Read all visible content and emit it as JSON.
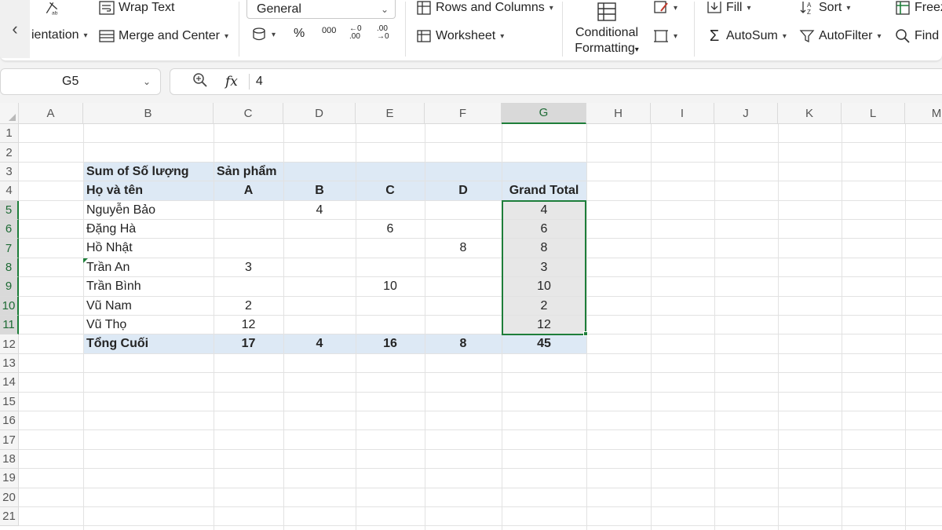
{
  "ribbon": {
    "orientation_label": "ientation",
    "wrap_text": "Wrap Text",
    "merge_center": "Merge and Center",
    "number_format": "General",
    "percent": "%",
    "comma": "000",
    "dec_increase": "←0 .00",
    "dec_decrease": ".00 →0",
    "rows_columns": "Rows and Columns",
    "worksheet": "Worksheet",
    "conditional_line1": "Conditional",
    "conditional_line2": "Formatting",
    "fill": "Fill",
    "sort": "Sort",
    "autosum": "AutoSum",
    "autofilter": "AutoFilter",
    "freeze": "Freez",
    "find": "Find"
  },
  "formula_bar": {
    "cell_ref": "G5",
    "fx": "fx",
    "value": "4"
  },
  "columns": [
    "A",
    "B",
    "C",
    "D",
    "E",
    "F",
    "G",
    "H",
    "I",
    "J",
    "K",
    "L",
    "M"
  ],
  "rows": [
    "1",
    "2",
    "3",
    "4",
    "5",
    "6",
    "7",
    "8",
    "9",
    "10",
    "11",
    "12",
    "13",
    "14",
    "15",
    "16",
    "17",
    "18",
    "19",
    "20",
    "21"
  ],
  "selected_column": "G",
  "pivot": {
    "title": "Sum of Số lượng",
    "col_header": "Sản phẩm",
    "row_header": "Họ và tên",
    "products": [
      "A",
      "B",
      "C",
      "D"
    ],
    "grand_total_label": "Grand Total",
    "people": [
      {
        "name": "Nguyễn Bảo",
        "A": "",
        "B": "4",
        "C": "",
        "D": "",
        "total": "4"
      },
      {
        "name": "Đặng Hà",
        "A": "",
        "B": "",
        "C": "6",
        "D": "",
        "total": "6"
      },
      {
        "name": "Hồ Nhật",
        "A": "",
        "B": "",
        "C": "",
        "D": "8",
        "total": "8"
      },
      {
        "name": "Trần An",
        "A": "3",
        "B": "",
        "C": "",
        "D": "",
        "total": "3"
      },
      {
        "name": "Trần Bình",
        "A": "",
        "B": "",
        "C": "10",
        "D": "",
        "total": "10"
      },
      {
        "name": "Vũ Nam",
        "A": "2",
        "B": "",
        "C": "",
        "D": "",
        "total": "2"
      },
      {
        "name": "Vũ Thọ",
        "A": "12",
        "B": "",
        "C": "",
        "D": "",
        "total": "12"
      }
    ],
    "footer": {
      "label": "Tổng Cuối",
      "A": "17",
      "B": "4",
      "C": "16",
      "D": "8",
      "total": "45"
    }
  },
  "colors": {
    "accent": "#1e7e3a",
    "pivot_band": "#dde9f5",
    "selection_fill": "#e7e7e7"
  }
}
